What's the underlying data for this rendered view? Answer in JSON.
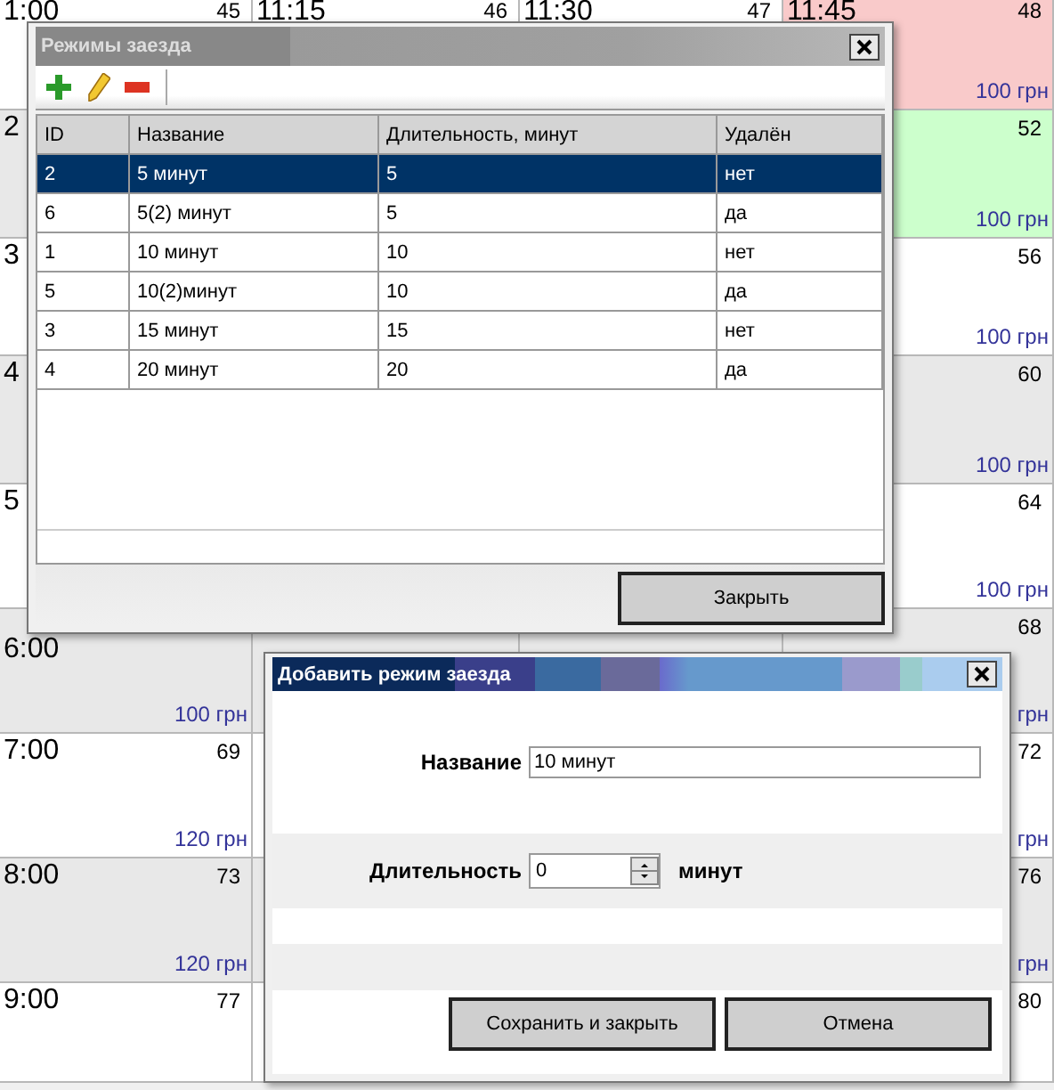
{
  "schedule": {
    "rows": [
      {
        "cells": [
          {
            "time": "1:00",
            "number": "45"
          },
          {
            "time": "11:15",
            "number": "46"
          },
          {
            "time": "11:30",
            "number": "47"
          },
          {
            "time": "11:45",
            "number": "48",
            "price": "100 грн",
            "color": "#f9caca"
          }
        ]
      },
      {
        "cells": [
          {
            "time": "2"
          },
          {},
          {},
          {
            "number": "52",
            "price": "100 грн",
            "color": "#ccffcc"
          }
        ]
      },
      {
        "cells": [
          {
            "time": "3"
          },
          {},
          {},
          {
            "number": "56",
            "price": "100 грн"
          }
        ]
      },
      {
        "cells": [
          {
            "time": "4"
          },
          {},
          {},
          {
            "number": "60",
            "price": "100 грн"
          }
        ]
      },
      {
        "cells": [
          {
            "time": "5"
          },
          {},
          {},
          {
            "number": "64",
            "price": "100 грн"
          }
        ]
      },
      {
        "cells": [
          {
            "time": "6:00",
            "price": "100 грн"
          },
          {},
          {},
          {
            "number": "68",
            "price": "грн"
          }
        ]
      },
      {
        "cells": [
          {
            "time": "7:00",
            "number": "69",
            "price": "120 грн"
          },
          {},
          {},
          {
            "number": "72",
            "price": "грн"
          }
        ]
      },
      {
        "cells": [
          {
            "time": "8:00",
            "number": "73",
            "price": "120 грн"
          },
          {},
          {},
          {
            "number": "76",
            "price": "грн"
          }
        ]
      },
      {
        "cells": [
          {
            "time": "9:00",
            "number": "77"
          },
          {},
          {},
          {
            "number": "80"
          }
        ]
      }
    ]
  },
  "modes_dialog": {
    "title": "Режимы заезда",
    "toolbar": [
      {
        "kind": "add"
      },
      {
        "kind": "edit"
      },
      {
        "kind": "delete"
      }
    ],
    "columns": [
      "ID",
      "Название",
      "Длительность, минут",
      "Удалён"
    ],
    "rows": [
      {
        "id": "2",
        "name": "5 минут",
        "duration": "5",
        "deleted": "нет",
        "selected": true
      },
      {
        "id": "6",
        "name": "5(2) минут",
        "duration": "5",
        "deleted": "да",
        "selected": false
      },
      {
        "id": "1",
        "name": "10 минут",
        "duration": "10",
        "deleted": "нет",
        "selected": false
      },
      {
        "id": "5",
        "name": "10(2)минут",
        "duration": "10",
        "deleted": "да",
        "selected": false
      },
      {
        "id": "3",
        "name": "15 минут",
        "duration": "15",
        "deleted": "нет",
        "selected": false
      },
      {
        "id": "4",
        "name": "20 минут",
        "duration": "20",
        "deleted": "да",
        "selected": false
      }
    ],
    "close_button": "Закрыть"
  },
  "add_dialog": {
    "title": "Добавить режим заезда",
    "name_label": "Название",
    "name_value": "10 минут",
    "duration_label": "Длительность",
    "duration_value": "0",
    "duration_unit": "минут",
    "buttons": [
      "Сохранить и закрыть",
      "Отмена"
    ]
  }
}
